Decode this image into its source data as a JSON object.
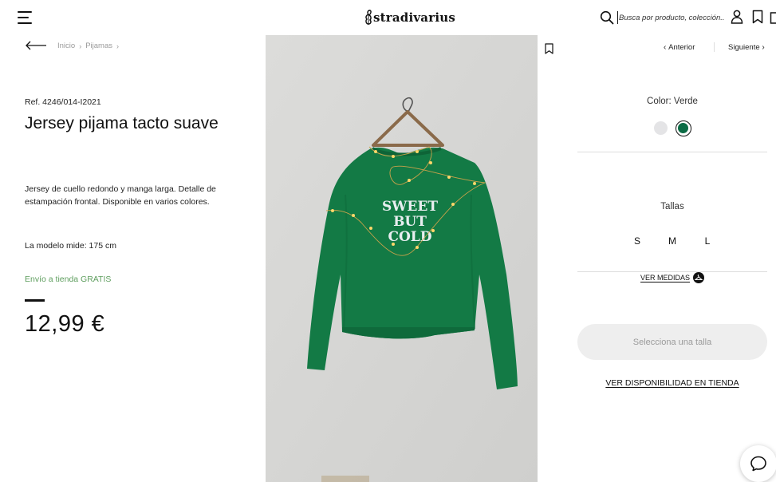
{
  "header": {
    "logo_text": "stradivarius",
    "search_placeholder": "Busca por producto, colección..."
  },
  "breadcrumb": {
    "items": [
      "Inicio",
      "Pijamas"
    ]
  },
  "product": {
    "ref": "Ref. 4246/014-I2021",
    "title": "Jersey pijama tacto suave",
    "description": "Jersey de cuello redondo y manga larga. Detalle de estampación frontal. Disponible en varios colores.",
    "model_height": "La modelo mide: 175 cm",
    "shipping": "Envío a tienda GRATIS",
    "price": "12,99 €",
    "image_print_lines": [
      "SWEET",
      "BUT",
      "COLD"
    ]
  },
  "navigation": {
    "prev_label": "Anterior",
    "next_label": "Siguiente"
  },
  "color": {
    "label": "Color: Verde",
    "swatches": [
      {
        "name": "gris",
        "hex": "#e4e4e6",
        "selected": false
      },
      {
        "name": "verde",
        "hex": "#0b6b45",
        "selected": true
      }
    ]
  },
  "sizes": {
    "label": "Tallas",
    "options": [
      "S",
      "M",
      "L"
    ],
    "measures_link": "VER MEDIDAS"
  },
  "actions": {
    "select_size_label": "Selecciona una talla",
    "availability_label": "VER DISPONIBILIDAD EN TIENDA"
  },
  "colors": {
    "accent_green": "#5e9e5e",
    "sweater_green": "#137a45",
    "button_bg": "#eeeeee"
  },
  "icons": [
    "menu-icon",
    "search-icon",
    "user-icon",
    "wishlist-icon",
    "bag-icon",
    "back-arrow-icon",
    "bookmark-icon",
    "hanger-icon",
    "chat-icon"
  ]
}
